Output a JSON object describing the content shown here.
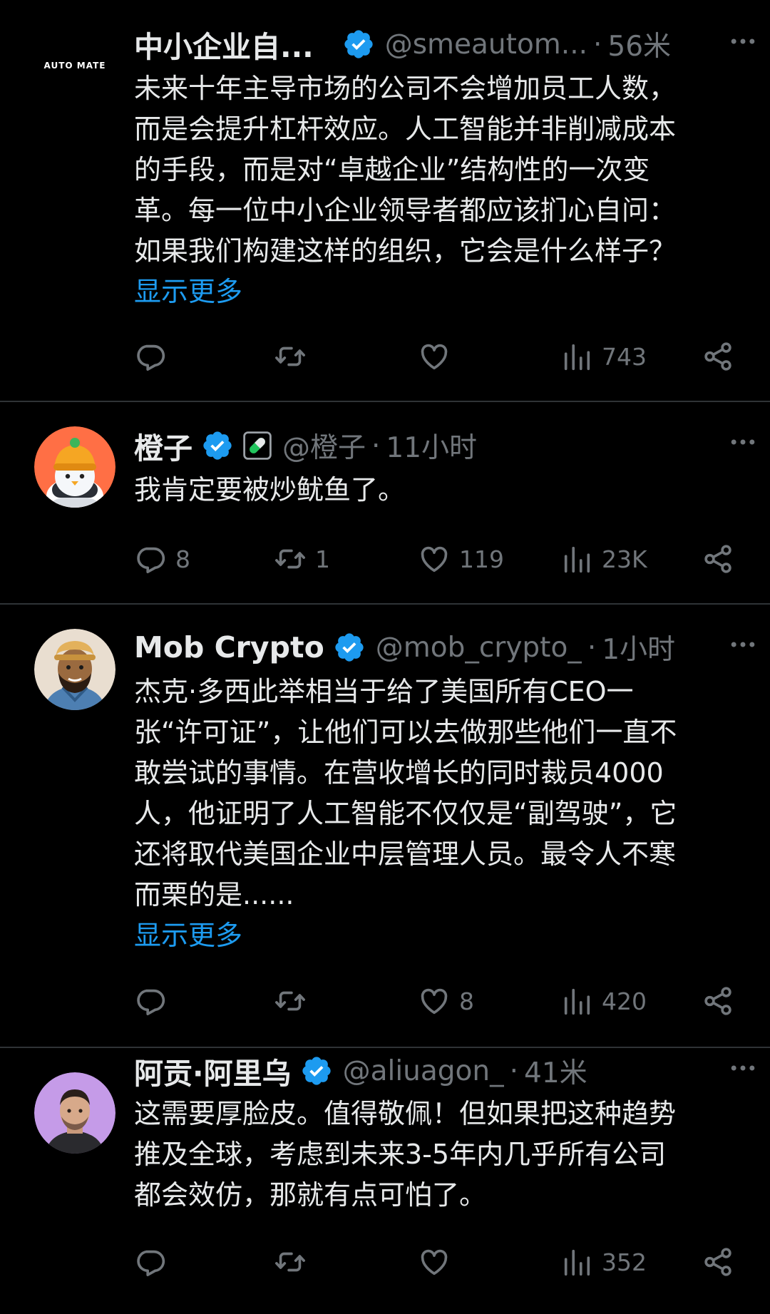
{
  "tweets": [
    {
      "author": {
        "name": "中小企业自...",
        "handle": "@smeautom...",
        "time": "56米",
        "verified": true,
        "avatar_icon": "automate-logo",
        "logo_text": "AUTO MATE"
      },
      "lines": [
        "未来十年主导市场的公司不会增加员工人数，",
        "而是会提升杠杆效应。人工智能并非削减成本",
        "的手段，而是对“卓越企业”结构性的一次变",
        "革。每一位中小企业领导者都应该扪心自问：",
        "如果我们构建这样的组织，它会是什么样子？"
      ],
      "show_more": "显示更多",
      "stats": {
        "replies": "",
        "retweets": "",
        "likes": "",
        "views": "743"
      }
    },
    {
      "author": {
        "name": "橙子",
        "handle": "@橙子",
        "time": "11小时",
        "verified": true,
        "badge_icon": "pill-icon",
        "avatar_icon": "penguin-orange-beanie"
      },
      "lines": [
        "我肯定要被炒鱿鱼了。"
      ],
      "stats": {
        "replies": "8",
        "retweets": "1",
        "likes": "119",
        "views": "23K"
      }
    },
    {
      "author": {
        "name": "Mob Crypto",
        "handle": "@mob_crypto_",
        "time": "1小时",
        "verified": true,
        "avatar_icon": "cartoon-man-cap"
      },
      "lines": [
        "杰克·多西此举相当于给了美国所有CEO一",
        "张“许可证”，让他们可以去做那些他们一直不",
        "敢尝试的事情。在营收增长的同时裁员4000",
        "人，他证明了人工智能不仅仅是“副驾驶”，它",
        "还将取代美国企业中层管理人员。最令人不寒",
        "而栗的是......"
      ],
      "show_more": "显示更多",
      "stats": {
        "replies": "",
        "retweets": "",
        "likes": "8",
        "views": "420"
      }
    },
    {
      "author": {
        "name": "阿贡·阿里乌",
        "handle": "@aliuagon_",
        "time": "41米",
        "verified": true,
        "avatar_icon": "man-photo-purple"
      },
      "lines": [
        "这需要厚脸皮。值得敬佩！但如果把这种趋势",
        "推及全球，考虑到未来3-5年内几乎所有公司",
        "都会效仿，那就有点可怕了。"
      ],
      "stats": {
        "replies": "",
        "retweets": "",
        "likes": "",
        "views": "352"
      }
    }
  ],
  "colors": {
    "background": "#000000",
    "text": "#e7e9ea",
    "muted": "#71767b",
    "link": "#1d9bf0",
    "verified": "#1d9bf0",
    "divider": "#2f3336",
    "pill": "#22c55e"
  },
  "separator": "·"
}
